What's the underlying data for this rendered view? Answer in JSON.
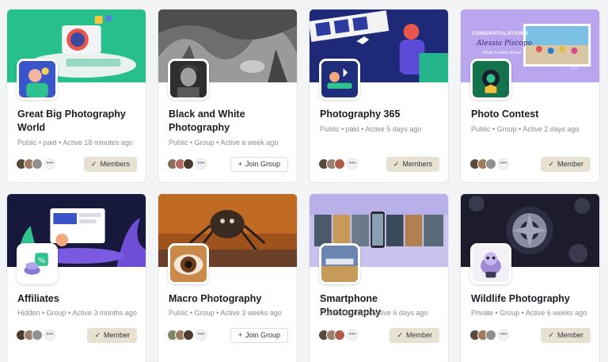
{
  "groups": [
    {
      "title": "Great Big Photography World",
      "meta": "Public • paid • Active 18 minutes ago",
      "button": "Members",
      "button_icon": "check-icon"
    },
    {
      "title": "Black and White Photography",
      "meta": "Public • Group • Active a week ago",
      "button": "Join Group",
      "button_icon": "plus-icon"
    },
    {
      "title": "Photography 365",
      "meta": "Public • paid • Active 5 days ago",
      "button": "Members",
      "button_icon": "check-icon"
    },
    {
      "title": "Photo Contest",
      "meta": "Public • Group • Active 2 days ago",
      "button": "Member",
      "button_icon": "check-icon",
      "cover_text": {
        "line1": "CONGRATULATIONS",
        "line2": "Alessia Piscopo",
        "line3": "Photo Contest Winner"
      }
    },
    {
      "title": "Affiliates",
      "meta": "Hidden • Group • Active 3 months ago",
      "button": "Member",
      "button_icon": "check-icon"
    },
    {
      "title": "Macro Photography",
      "meta": "Public • Group • Active 3 weeks ago",
      "button": "Join Group",
      "button_icon": "plus-icon"
    },
    {
      "title": "Smartphone Photography",
      "meta": "Public • Group • Active 6 days ago",
      "button": "Member",
      "button_icon": "check-icon"
    },
    {
      "title": "Wildlife Photography",
      "meta": "Private • Group • Active 6 weeks ago",
      "button": "Member",
      "button_icon": "check-icon"
    }
  ],
  "more_label": "•••",
  "colors": {
    "member_button": "#e7e1d2",
    "title": "#1b1d24",
    "meta": "#8a8d96"
  }
}
